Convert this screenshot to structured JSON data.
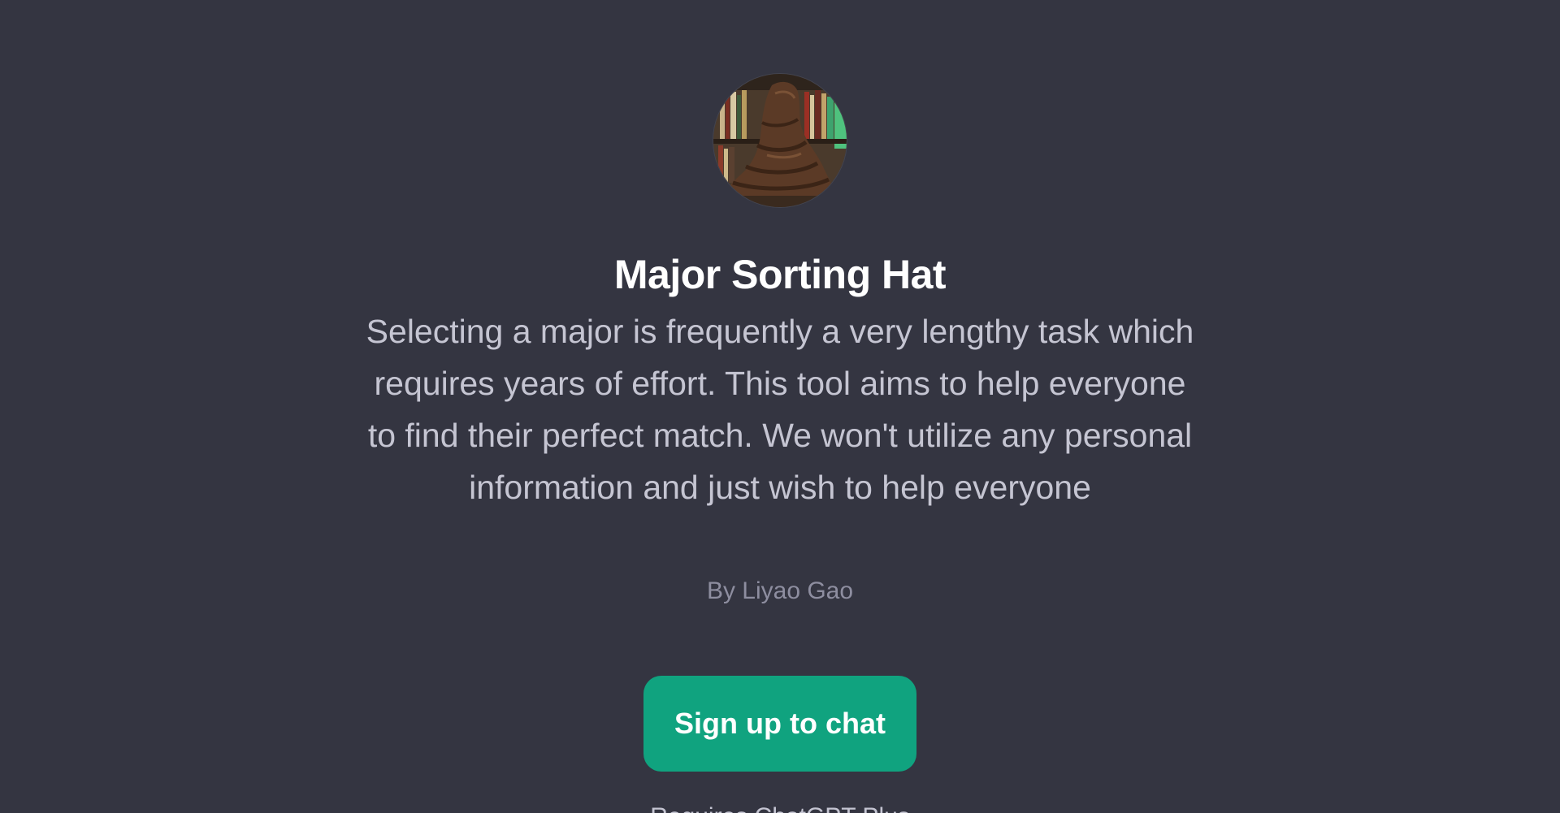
{
  "gpt": {
    "avatar_icon": "sorting-hat-image",
    "title": "Major Sorting Hat",
    "description": "Selecting a major is frequently a very lengthy task which requires years of effort. This tool aims to help everyone to find their perfect match. We won't utilize any personal information and just wish to help everyone",
    "author": "By Liyao Gao"
  },
  "actions": {
    "signup_label": "Sign up to chat"
  },
  "footer": {
    "note": "Requires ChatGPT Plus"
  },
  "colors": {
    "background": "#343541",
    "accent": "#10a37f",
    "title": "#ffffff",
    "description": "#c5c5d2",
    "author": "#8e8ea0"
  }
}
